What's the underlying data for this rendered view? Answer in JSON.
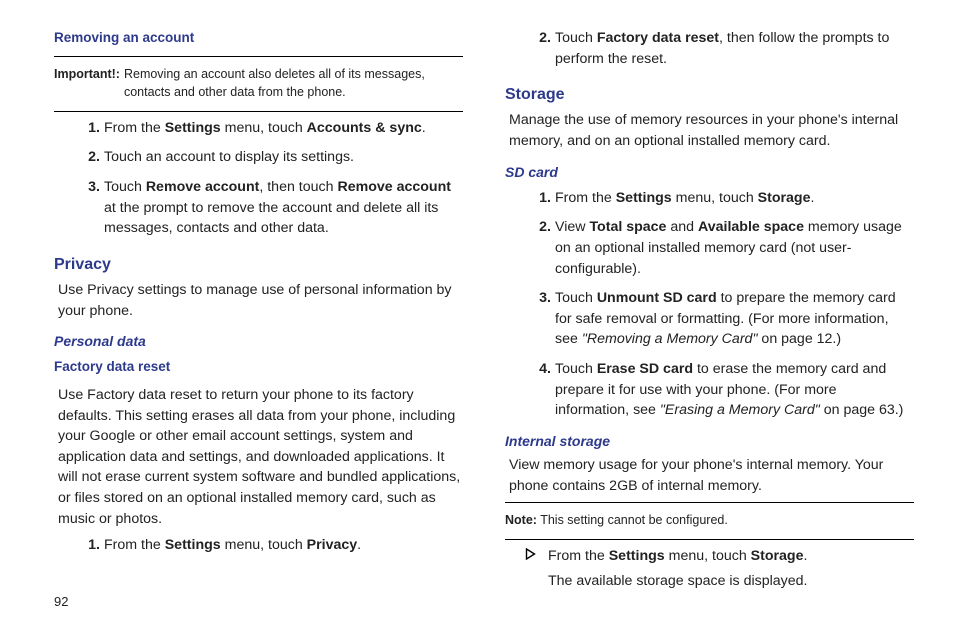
{
  "left": {
    "removing_heading": "Removing an account",
    "important_label": "Important!:",
    "important_text": "Removing an account also deletes all of its messages, contacts and other data from the phone.",
    "steps_remove": [
      {
        "pre": "From the ",
        "b1": "Settings",
        "mid": " menu, touch ",
        "b2": "Accounts & sync",
        "post": "."
      },
      {
        "text": "Touch an account to display its settings."
      },
      {
        "pre": "Touch ",
        "b1": "Remove account",
        "mid": ", then touch ",
        "b2": "Remove account",
        "post": " at the prompt to remove the account and delete all its messages, contacts and other data."
      }
    ],
    "privacy_heading": "Privacy",
    "privacy_text": "Use Privacy settings to manage use of personal information by your phone.",
    "personal_data_heading": "Personal data",
    "factory_heading": "Factory data reset",
    "factory_text": "Use Factory data reset to return your phone to its factory defaults. This setting erases all data from your phone, including your Google or other email account settings, system and application data and settings, and downloaded applications. It will not erase current system software and bundled applications, or files stored on an optional installed memory card, such as music or photos.",
    "step_privacy": {
      "pre": "From the ",
      "b1": "Settings",
      "mid": " menu, touch ",
      "b2": "Privacy",
      "post": "."
    }
  },
  "right": {
    "step2_factory": {
      "pre": "Touch ",
      "b1": "Factory data reset",
      "post": ", then follow the prompts to perform the reset."
    },
    "storage_heading": "Storage",
    "storage_text": "Manage the use of memory resources in your phone's internal memory, and on an optional installed memory card.",
    "sd_heading": "SD card",
    "sd_steps": [
      {
        "pre": "From the ",
        "b1": "Settings",
        "mid": " menu, touch ",
        "b2": "Storage",
        "post": "."
      },
      {
        "pre": "View ",
        "b1": "Total space",
        "mid": " and ",
        "b2": "Available space",
        "post": " memory usage on an optional installed memory card (not user-configurable)."
      },
      {
        "pre": "Touch ",
        "b1": "Unmount SD card",
        "post1": " to prepare the memory card for safe removal or formatting. (For more information, see ",
        "ref": "\"Removing a Memory Card\"",
        "post2": " on page 12.)"
      },
      {
        "pre": "Touch ",
        "b1": "Erase SD card",
        "post1": " to erase the memory card and prepare it for use with your phone. (For more information, see ",
        "ref": "\"Erasing a Memory Card\"",
        "post2": " on page 63.)"
      }
    ],
    "internal_heading": "Internal storage",
    "internal_text": "View memory usage for your phone's internal memory. Your phone contains 2GB of internal memory.",
    "note_label": "Note:",
    "note_text": "This setting cannot be configured.",
    "bullet_line1_pre": "From the ",
    "bullet_line1_b1": "Settings",
    "bullet_line1_mid": " menu, touch ",
    "bullet_line1_b2": "Storage",
    "bullet_line1_post": ".",
    "bullet_line2": "The available storage space is displayed."
  },
  "page_number": "92"
}
